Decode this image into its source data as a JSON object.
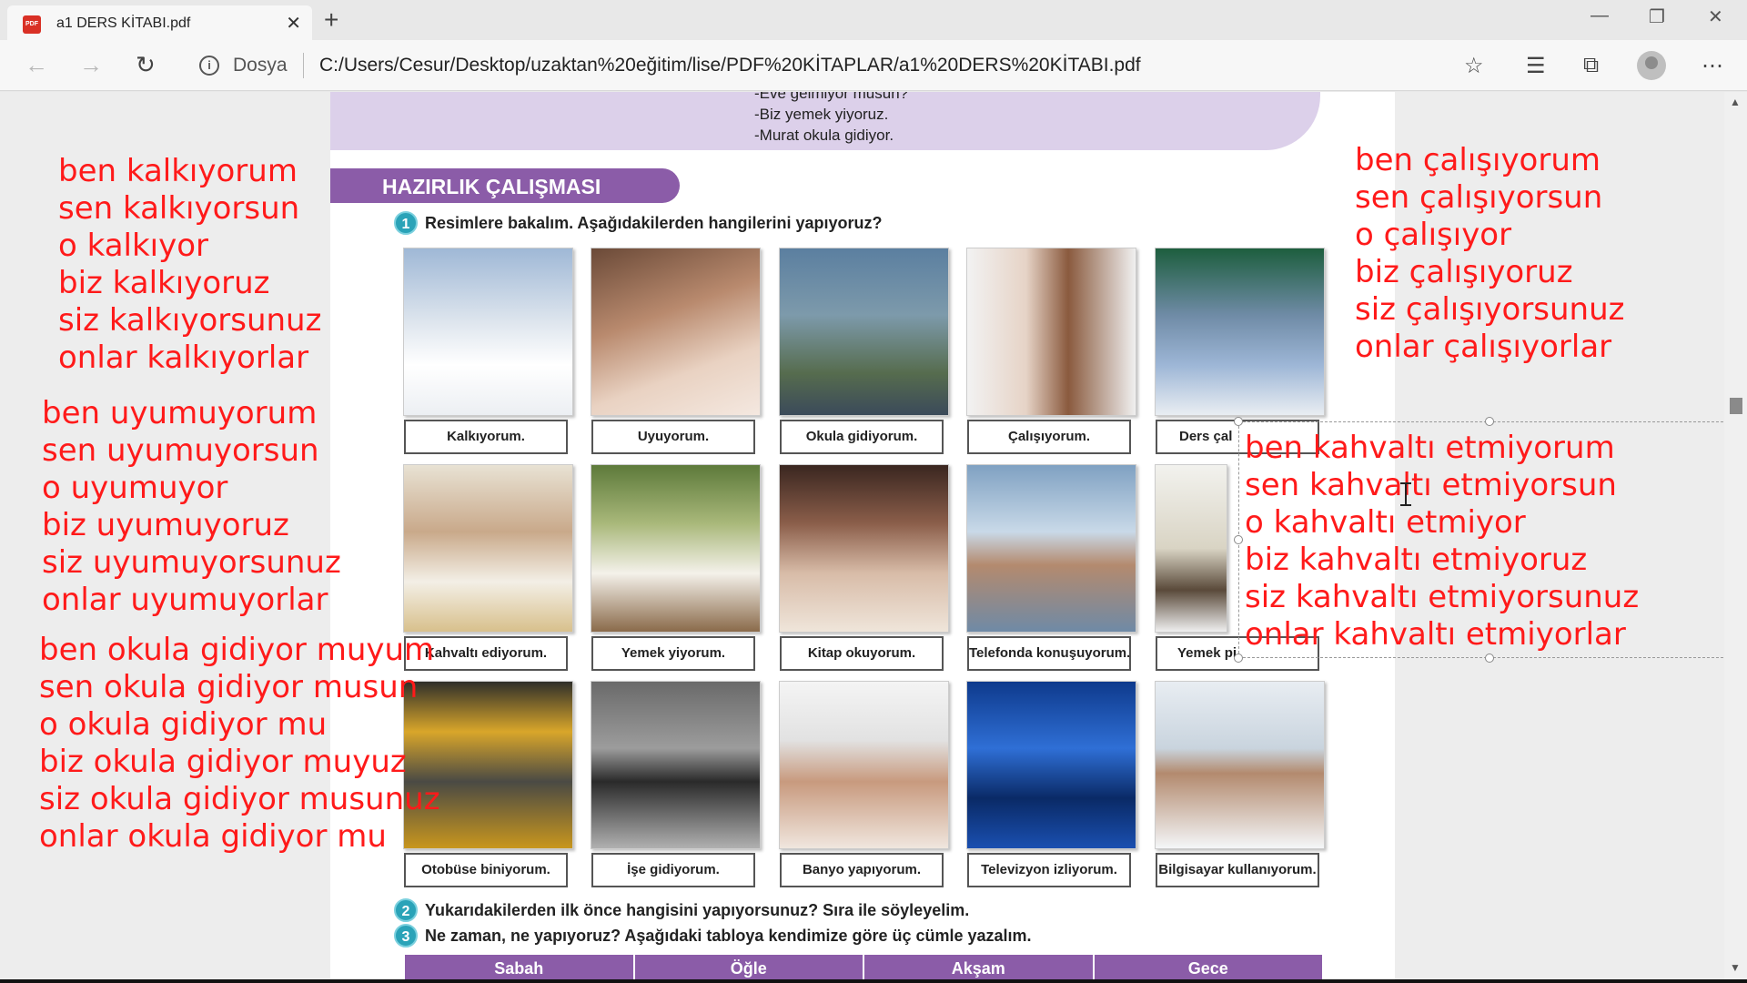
{
  "browser": {
    "tab_title": "a1 DERS KİTABI.pdf",
    "tab_icon_text": "PDF",
    "address_label": "Dosya",
    "address_url": "C:/Users/Cesur/Desktop/uzaktan%20eğitim/lise/PDF%20KİTAPLAR/a1%20DERS%20KİTABI.pdf"
  },
  "pdf": {
    "dialog_lines": [
      "-Eve gelmiyor musun?",
      "-Biz yemek yiyoruz.",
      "-Murat okula gidiyor."
    ],
    "section_title": "HAZIRLIK ÇALIŞMASI",
    "question1": {
      "num": "1",
      "text": "Resimlere bakalım. Aşağıdakilerden hangilerini yapıyoruz?"
    },
    "captions_row1": [
      "Kalkıyorum.",
      "Uyuyorum.",
      "Okula gidiyorum.",
      "Çalışıyorum.",
      "Ders çal"
    ],
    "captions_row2": [
      "Kahvaltı ediyorum.",
      "Yemek yiyorum.",
      "Kitap okuyorum.",
      "Telefonda konuşuyorum.",
      "Yemek pi"
    ],
    "captions_row3": [
      "Otobüse biniyorum.",
      "İşe gidiyorum.",
      "Banyo yapıyorum.",
      "Televizyon izliyorum.",
      "Bilgisayar kullanıyorum."
    ],
    "question2": {
      "num": "2",
      "text": "Yukarıdakilerden ilk önce hangisini yapıyorsunuz? Sıra ile söyleyelim."
    },
    "question3": {
      "num": "3",
      "text": "Ne zaman, ne yapıyoruz? Aşağıdaki tabloya kendimize göre üç cümle yazalım."
    },
    "table_headers": [
      "Sabah",
      "Öğle",
      "Akşam",
      "Gece"
    ]
  },
  "notes": {
    "kalkmak": [
      "ben kalkıyorum",
      "sen kalkıyorsun",
      "o kalkıyor",
      "biz kalkıyoruz",
      "siz kalkıyorsunuz",
      "onlar kalkıyorlar"
    ],
    "uyumak": [
      "ben uyumuyorum",
      "sen uyumuyorsun",
      "o uyumuyor",
      "biz uyumuyoruz",
      "siz uyumuyorsunuz",
      "onlar uyumuyorlar"
    ],
    "okula_gitmek": [
      "ben okula gidiyor muyum",
      "sen okula gidiyor musun",
      "o okula gidiyor mu",
      "biz okula gidiyor muyuz",
      "siz okula gidiyor musunuz",
      "onlar okula gidiyor mu"
    ],
    "calismak": [
      "ben çalışıyorum",
      "sen çalışıyorsun",
      "o çalışıyor",
      "biz çalışıyoruz",
      "siz çalışıyorsunuz",
      "onlar çalışıyorlar"
    ],
    "kahvalti": [
      "ben kahvaltı etmiyorum",
      "sen kahvaltı etmiyorsun",
      "o kahvaltı etmiyor",
      "biz kahvaltı etmiyoruz",
      "siz kahvaltı etmiyorsunuz",
      "onlar kahvaltı etmiyorlar"
    ]
  },
  "colors": {
    "annotation": "#ff1a1a",
    "section_purple": "#8b5ca8",
    "question_teal": "#2aa3b8"
  }
}
